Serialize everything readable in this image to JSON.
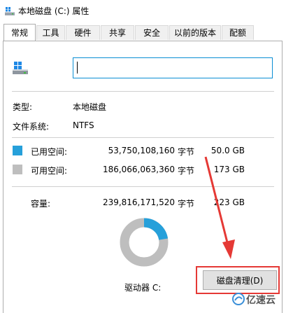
{
  "window": {
    "title": "本地磁盘 (C:) 属性"
  },
  "tabs": [
    {
      "label": "常规",
      "active": true
    },
    {
      "label": "工具",
      "active": false
    },
    {
      "label": "硬件",
      "active": false
    },
    {
      "label": "共享",
      "active": false
    },
    {
      "label": "安全",
      "active": false
    },
    {
      "label": "以前的版本",
      "active": false
    },
    {
      "label": "配额",
      "active": false
    }
  ],
  "general": {
    "name_value": "",
    "type_label": "类型:",
    "type_value": "本地磁盘",
    "fs_label": "文件系统:",
    "fs_value": "NTFS",
    "used": {
      "label": "已用空间:",
      "bytes": "53,750,108,160",
      "unit": "字节",
      "size": "50.0 GB",
      "color": "#26a0da"
    },
    "free": {
      "label": "可用空间:",
      "bytes": "186,066,063,360",
      "unit": "字节",
      "size": "173 GB",
      "color": "#bebebe"
    },
    "capacity": {
      "label": "容量:",
      "bytes": "239,816,171,520",
      "unit": "字节",
      "size": "223 GB"
    },
    "used_fraction": 0.224,
    "drive_label": "驱动器 C:",
    "cleanup_button": "磁盘清理(D)"
  },
  "watermark": {
    "text": "亿速云"
  },
  "colors": {
    "accent": "#0a8ed4",
    "annotation_red": "#e53935"
  }
}
